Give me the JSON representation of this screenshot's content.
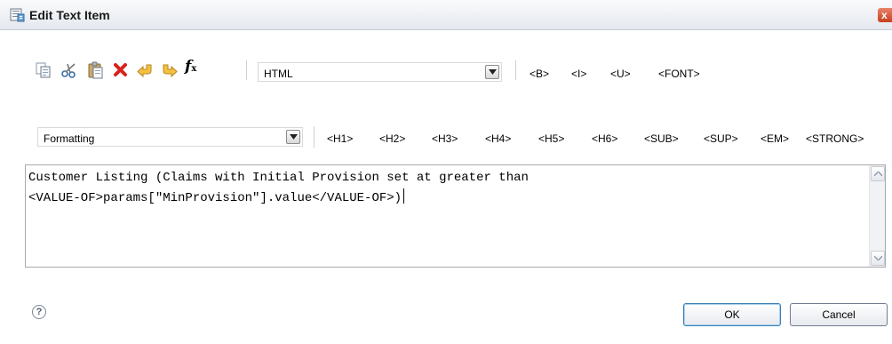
{
  "window": {
    "title": "Edit Text Item",
    "close_glyph": "x"
  },
  "toolbar": {
    "icons": [
      "copy-icon",
      "cut-icon",
      "paste-icon",
      "delete-icon",
      "undo-icon",
      "redo-icon",
      "function-icon"
    ],
    "function_glyph": "f",
    "function_sub": "x",
    "format_select": {
      "value": "HTML"
    },
    "tags_row1": [
      "<B>",
      "<I>",
      "<U>",
      "<FONT>"
    ]
  },
  "formatting": {
    "select": {
      "value": "Formatting"
    },
    "tags_row2": [
      "<H1>",
      "<H2>",
      "<H3>",
      "<H4>",
      "<H5>",
      "<H6>",
      "<SUB>",
      "<SUP>",
      "<EM>",
      "<STRONG>"
    ]
  },
  "editor": {
    "lines": [
      "Customer Listing (Claims with Initial Provision set at greater than",
      "<VALUE-OF>params[\"MinProvision\"].value</VALUE-OF>)"
    ]
  },
  "footer": {
    "help_glyph": "?",
    "ok_label": "OK",
    "cancel_label": "Cancel"
  },
  "colors": {
    "delete": "#d9221c",
    "arrows": "#e5a823",
    "close_button": "#d2583a"
  }
}
